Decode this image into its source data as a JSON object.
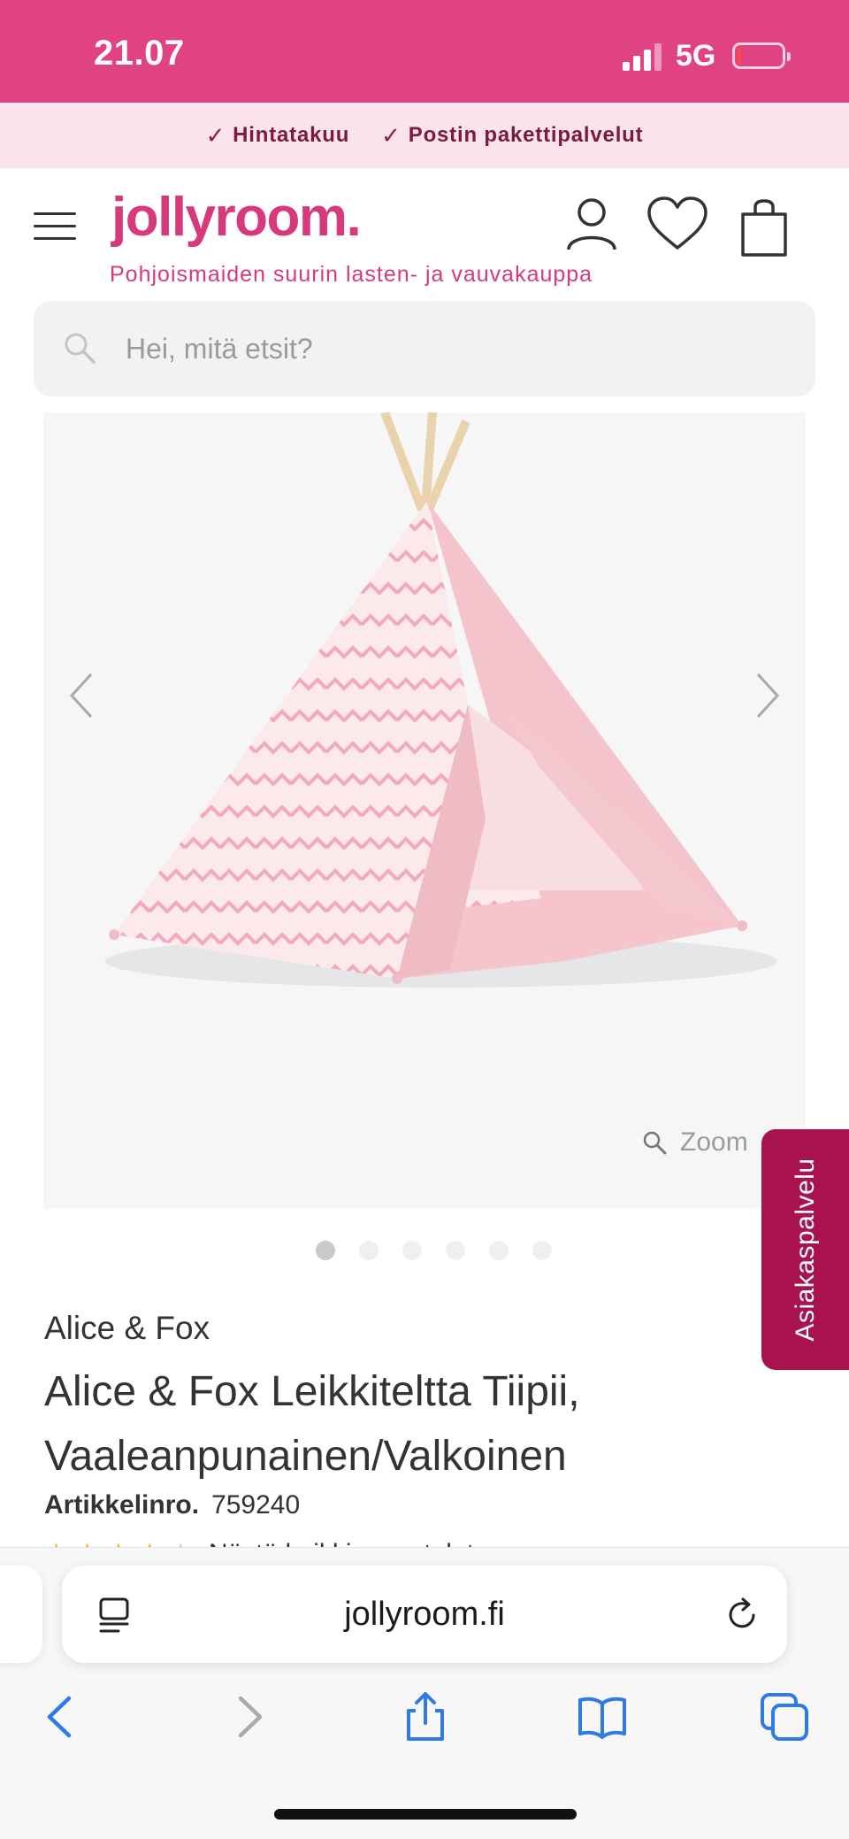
{
  "status_bar": {
    "time": "21.07",
    "network": "5G",
    "background": "#df4383"
  },
  "usp_bar": {
    "items": [
      "Hintatakuu",
      "Postin pakettipalvelut"
    ]
  },
  "header": {
    "logo": "jollyroom.",
    "tagline": "Pohjoismaiden suurin lasten- ja vauvakauppa",
    "brand_color": "#d63a7c",
    "icons": [
      "menu-icon",
      "account-icon",
      "wishlist-heart-icon",
      "cart-bag-icon"
    ]
  },
  "search": {
    "placeholder": "Hei, mitä etsit?"
  },
  "gallery": {
    "zoom_label": "Zoom",
    "image_count": 6,
    "active_index": 0
  },
  "product": {
    "brand": "Alice & Fox",
    "title": "Alice & Fox Leikkiteltta Tiipii, Vaaleanpunainen/Valkoinen",
    "sku_label": "Artikkelinro.",
    "sku": "759240",
    "rating_text": "Näytä kaikki arvostelut"
  },
  "customer_service": {
    "label": "Asiakaspalvelu",
    "color": "#a7124f"
  },
  "browser": {
    "url": "jollyroom.fi",
    "toolbar": [
      "back-icon",
      "forward-icon",
      "share-icon",
      "bookmarks-icon",
      "tabs-icon"
    ],
    "accent": "#2f7ae5"
  }
}
